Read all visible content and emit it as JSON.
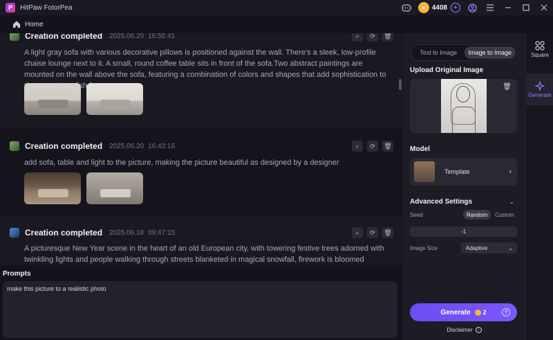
{
  "window": {
    "title": "HitPaw FotorPea",
    "credits": "4408"
  },
  "header": {
    "home_label": "Home"
  },
  "feed": [
    {
      "title": "Creation completed",
      "date": "2025.06.20",
      "time": "16:55:41",
      "text": "A light gray sofa with various decorative pillows is positioned against the wall. There's a sleek, low-profile chaise lounge next to it. A small, round coffee table sits in front of the sofa.Two abstract paintings are mounted on the wall above the sofa, featuring a combination of colors and shapes that add sophistication to the space.A stylish f..."
    },
    {
      "title": "Creation completed",
      "date": "2025.06.20",
      "time": "16:43:15",
      "text": "add sofa, table and light to the picture, making the picture beautiful as designed by a designer"
    },
    {
      "title": "Creation completed",
      "date": "2025.06.18",
      "time": "09:47:15",
      "text": "A picturesque New Year scene in the heart of an old European city, with towering festive trees adorned with twinkling lights and people walking through streets blanketed in magical snowfall, firework is bloomed faraway."
    }
  ],
  "prompts": {
    "label": "Prompts",
    "value": "make this picture to a realistic photo"
  },
  "panel": {
    "modes": [
      "Text to Image",
      "Image to Image"
    ],
    "active_mode": "Image to Image",
    "upload_title": "Upload Original Image",
    "model_title": "Model",
    "model_name": "Template",
    "advanced_title": "Advanced Settings",
    "seed_label": "Seed",
    "seed_options": [
      "Random",
      "Custom"
    ],
    "seed_value": "-1",
    "size_label": "Image Size",
    "size_value": "Adaptive",
    "generate_label": "Generate",
    "generate_cost": "2",
    "disclaimer": "Disclaimer"
  },
  "sidenav": [
    {
      "label": "Square",
      "icon": "square-grid-icon"
    },
    {
      "label": "Generate",
      "icon": "sparkle-icon"
    }
  ]
}
